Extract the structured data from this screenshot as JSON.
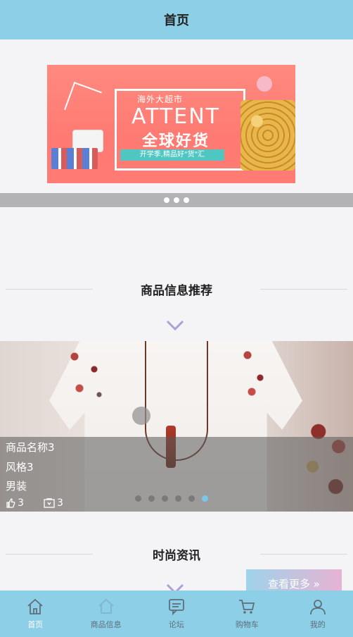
{
  "header": {
    "title": "首页"
  },
  "banner": {
    "top_text": "海外大超市",
    "main_text": "ATTENT",
    "cn_text": "全球好货",
    "pill_text": "开学季,精品好\"货\"汇",
    "dots": 3
  },
  "sections": {
    "products_title": "商品信息推荐",
    "news_title": "时尚资讯"
  },
  "product": {
    "name": "商品名称3",
    "style": "风格3",
    "category": "男装",
    "likes": "3",
    "collects": "3",
    "slide_count": 6,
    "active_index": 5
  },
  "more_button": {
    "label": "查看更多 »"
  },
  "tabbar": {
    "items": [
      {
        "label": "首页",
        "icon": "home-icon",
        "active": true
      },
      {
        "label": "商品信息",
        "icon": "product-icon",
        "active": false
      },
      {
        "label": "论坛",
        "icon": "chat-icon",
        "active": false
      },
      {
        "label": "购物车",
        "icon": "cart-icon",
        "active": false
      },
      {
        "label": "我的",
        "icon": "user-icon",
        "active": false
      }
    ]
  }
}
